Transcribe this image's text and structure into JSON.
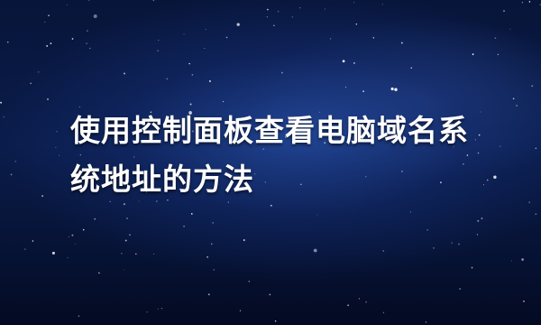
{
  "background": {
    "theme": "starry-night-sky",
    "colors": {
      "deep": "#050d28",
      "mid": "#0a1c4a",
      "glow": "#2850aa",
      "star": "#ffffff",
      "text": "#ffffff"
    }
  },
  "headline": {
    "text": "使用控制面板查看电脑域名系统地址的方法"
  }
}
